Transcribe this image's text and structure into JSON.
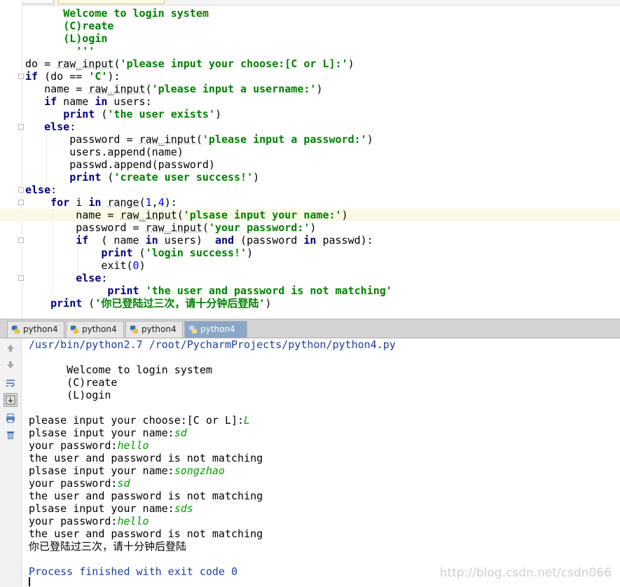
{
  "editor": {
    "lines": [
      [
        [
          "plain",
          "      "
        ],
        [
          "str",
          "Welcome to login system"
        ]
      ],
      [
        [
          "plain",
          "      "
        ],
        [
          "str",
          "(C)reate"
        ]
      ],
      [
        [
          "plain",
          "      "
        ],
        [
          "str",
          "(L)ogin"
        ]
      ],
      [
        [
          "plain",
          "      "
        ],
        [
          "str",
          "  '''"
        ]
      ],
      [
        [
          "plain",
          "do = "
        ],
        [
          "fn",
          "raw_input"
        ],
        [
          "plain",
          "("
        ],
        [
          "str",
          "'please input your choose:[C or L]:'"
        ],
        [
          "plain",
          ")"
        ]
      ],
      [
        [
          "kw",
          "if"
        ],
        [
          "plain",
          " (do == "
        ],
        [
          "str",
          "'C'"
        ],
        [
          "plain",
          "):"
        ]
      ],
      [
        [
          "plain",
          "   name = "
        ],
        [
          "fn",
          "raw_input"
        ],
        [
          "plain",
          "("
        ],
        [
          "str",
          "'please input a username:'"
        ],
        [
          "plain",
          ")"
        ]
      ],
      [
        [
          "plain",
          "   "
        ],
        [
          "kw",
          "if"
        ],
        [
          "plain",
          " name "
        ],
        [
          "kw",
          "in"
        ],
        [
          "plain",
          " users:"
        ]
      ],
      [
        [
          "plain",
          "      "
        ],
        [
          "kw",
          "print"
        ],
        [
          "plain",
          " ("
        ],
        [
          "str",
          "'the user exists'"
        ],
        [
          "plain",
          ")"
        ]
      ],
      [
        [
          "plain",
          "   "
        ],
        [
          "kw",
          "else"
        ],
        [
          "plain",
          ":"
        ]
      ],
      [
        [
          "plain",
          "       password = "
        ],
        [
          "fn",
          "raw_input"
        ],
        [
          "plain",
          "("
        ],
        [
          "str",
          "'please input a password:'"
        ],
        [
          "plain",
          ")"
        ]
      ],
      [
        [
          "plain",
          "       users.append(name)"
        ]
      ],
      [
        [
          "plain",
          "       passwd.append(password)"
        ]
      ],
      [
        [
          "plain",
          "       "
        ],
        [
          "kw",
          "print"
        ],
        [
          "plain",
          " ("
        ],
        [
          "str",
          "'create user success!'"
        ],
        [
          "plain",
          ")"
        ]
      ],
      [
        [
          "kw",
          "else"
        ],
        [
          "plain",
          ":"
        ]
      ],
      [
        [
          "plain",
          "    "
        ],
        [
          "kw",
          "for"
        ],
        [
          "plain",
          " i "
        ],
        [
          "kw",
          "in"
        ],
        [
          "plain",
          " "
        ],
        [
          "fn",
          "range"
        ],
        [
          "plain",
          "("
        ],
        [
          "num",
          "1"
        ],
        [
          "plain",
          ","
        ],
        [
          "num",
          "4"
        ],
        [
          "plain",
          "):"
        ]
      ],
      [
        [
          "plain",
          "        name = "
        ],
        [
          "fn",
          "raw_input"
        ],
        [
          "plain",
          "("
        ],
        [
          "str",
          "'plsase input your name:'"
        ],
        [
          "plain",
          ")"
        ]
      ],
      [
        [
          "plain",
          "        password = "
        ],
        [
          "fn",
          "raw_input"
        ],
        [
          "plain",
          "("
        ],
        [
          "str",
          "'your password:'"
        ],
        [
          "plain",
          ")"
        ]
      ],
      [
        [
          "plain",
          "        "
        ],
        [
          "kw",
          "if"
        ],
        [
          "plain",
          "  ( name "
        ],
        [
          "kw",
          "in"
        ],
        [
          "plain",
          " users)  "
        ],
        [
          "kw",
          "and"
        ],
        [
          "plain",
          " (password "
        ],
        [
          "kw",
          "in"
        ],
        [
          "plain",
          " passwd):"
        ]
      ],
      [
        [
          "plain",
          "            "
        ],
        [
          "kw",
          "print"
        ],
        [
          "plain",
          " ("
        ],
        [
          "str",
          "'login success!'"
        ],
        [
          "plain",
          ")"
        ]
      ],
      [
        [
          "plain",
          "            exit("
        ],
        [
          "num",
          "0"
        ],
        [
          "plain",
          ")"
        ]
      ],
      [
        [
          "plain",
          "        "
        ],
        [
          "kw",
          "else"
        ],
        [
          "plain",
          ":"
        ]
      ],
      [
        [
          "plain",
          "             "
        ],
        [
          "kw",
          "print"
        ],
        [
          "plain",
          " "
        ],
        [
          "str",
          "'the user and password is not matching'"
        ]
      ],
      [
        [
          "plain",
          "    "
        ],
        [
          "kw",
          "print"
        ],
        [
          "plain",
          " ("
        ],
        [
          "str",
          "'你已登陆过三次，请十分钟后登陆'"
        ],
        [
          "plain",
          ")"
        ]
      ]
    ]
  },
  "tabs": [
    "python4",
    "python4",
    "python4",
    "python4"
  ],
  "console": {
    "command": "/usr/bin/python2.7 /root/PycharmProjects/python/python4.py",
    "lines": [
      [
        [
          "plain",
          ""
        ]
      ],
      [
        [
          "plain",
          "      Welcome to login system"
        ]
      ],
      [
        [
          "plain",
          "      (C)reate"
        ]
      ],
      [
        [
          "plain",
          "      (L)ogin"
        ]
      ],
      [
        [
          "plain",
          ""
        ]
      ],
      [
        [
          "plain",
          "please input your choose:[C or L]:"
        ],
        [
          "in",
          "L"
        ]
      ],
      [
        [
          "plain",
          "plsase input your name:"
        ],
        [
          "in",
          "sd"
        ]
      ],
      [
        [
          "plain",
          "your password:"
        ],
        [
          "in",
          "hello"
        ]
      ],
      [
        [
          "plain",
          "the user and password is not matching"
        ]
      ],
      [
        [
          "plain",
          "plsase input your name:"
        ],
        [
          "in",
          "songzhao"
        ]
      ],
      [
        [
          "plain",
          "your password:"
        ],
        [
          "in",
          "sd"
        ]
      ],
      [
        [
          "plain",
          "the user and password is not matching"
        ]
      ],
      [
        [
          "plain",
          "plsase input your name:"
        ],
        [
          "in",
          "sds"
        ]
      ],
      [
        [
          "plain",
          "your password:"
        ],
        [
          "in",
          "hello"
        ]
      ],
      [
        [
          "plain",
          "the user and password is not matching"
        ]
      ],
      [
        [
          "plain",
          "你已登陆过三次，请十分钟后登陆"
        ]
      ],
      [
        [
          "plain",
          ""
        ]
      ]
    ],
    "exit_message": "Process finished with exit code 0"
  },
  "tool_icons": [
    "up-arrow-icon",
    "down-arrow-icon",
    "soft-wrap-icon",
    "scroll-to-end-icon",
    "print-icon",
    "trash-icon"
  ],
  "watermark": "http://blog.csdn.net/csdn066",
  "colors": {
    "keyword": "#000080",
    "string": "#008000",
    "number": "#0000ff",
    "user_input": "#00a000",
    "process_text": "#1f3f9f",
    "active_tab": "#8aa7c8"
  }
}
